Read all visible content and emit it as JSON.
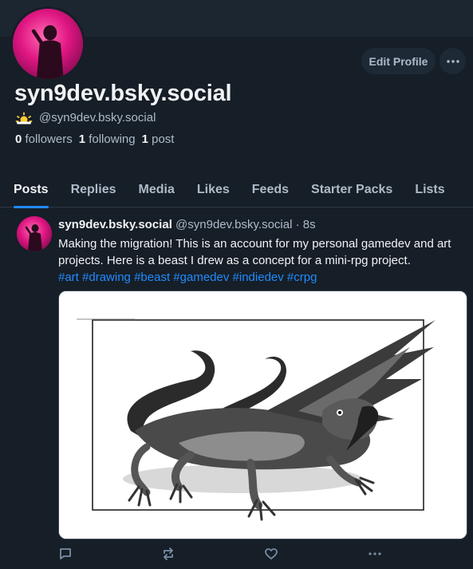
{
  "profile": {
    "display_name": "syn9dev.bsky.social",
    "handle": "@syn9dev.bsky.social",
    "emoji": "🌤",
    "followers_count": "0",
    "followers_label": "followers",
    "following_count": "1",
    "following_label": "following",
    "posts_count": "1",
    "posts_label": "post",
    "edit_button": "Edit Profile"
  },
  "tabs": [
    {
      "label": "Posts",
      "active": true
    },
    {
      "label": "Replies"
    },
    {
      "label": "Media"
    },
    {
      "label": "Likes"
    },
    {
      "label": "Feeds"
    },
    {
      "label": "Starter Packs"
    },
    {
      "label": "Lists"
    }
  ],
  "post": {
    "author_name": "syn9dev.bsky.social",
    "author_handle": "@syn9dev.bsky.social",
    "separator": "·",
    "time": "8s",
    "text": "Making the migration! This is an account for my personal gamedev and art projects. Here is a beast I drew as a concept for a mini-rpg project.",
    "hashtags": [
      "#art",
      "#drawing",
      "#beast",
      "#gamedev",
      "#indiedev",
      "#crpg"
    ]
  },
  "icons": {
    "more": "ellipsis-icon",
    "reply": "speech-bubble-icon",
    "repost": "repost-icon",
    "like": "heart-icon"
  },
  "colors": {
    "background": "#161e27",
    "accent": "#208bfe",
    "muted_text": "#aebbc9"
  }
}
